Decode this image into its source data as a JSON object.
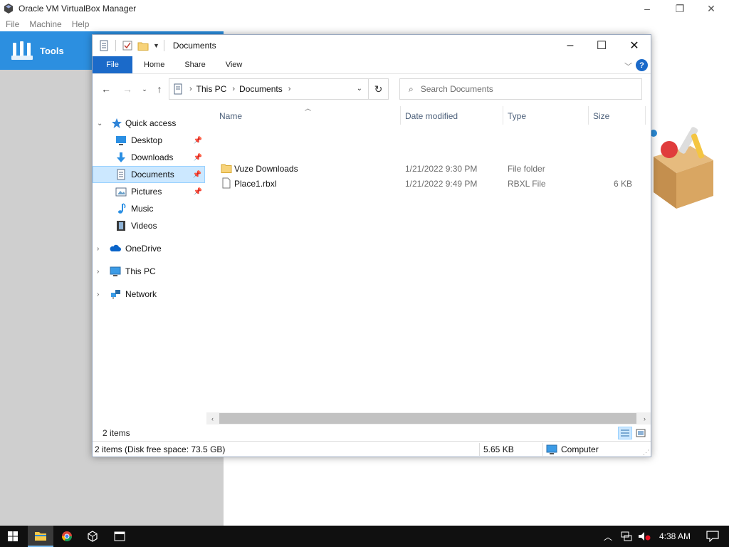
{
  "vbox": {
    "title": "Oracle VM VirtualBox Manager",
    "menu": [
      "File",
      "Machine",
      "Help"
    ],
    "tools_label": "Tools"
  },
  "explorer": {
    "title": "Documents",
    "ribbon_tabs": [
      "File",
      "Home",
      "Share",
      "View"
    ],
    "address": {
      "crumbs": [
        "This PC",
        "Documents"
      ]
    },
    "search": {
      "placeholder": "Search Documents"
    },
    "nav": {
      "quick_access": "Quick access",
      "items": [
        {
          "label": "Desktop",
          "icon": "desktop-icon",
          "pinned": true
        },
        {
          "label": "Downloads",
          "icon": "downloads-icon",
          "pinned": true
        },
        {
          "label": "Documents",
          "icon": "documents-icon",
          "pinned": true,
          "selected": true
        },
        {
          "label": "Pictures",
          "icon": "pictures-icon",
          "pinned": true
        },
        {
          "label": "Music",
          "icon": "music-icon",
          "pinned": false
        },
        {
          "label": "Videos",
          "icon": "videos-icon",
          "pinned": false
        }
      ],
      "roots": [
        {
          "label": "OneDrive",
          "icon": "onedrive-icon"
        },
        {
          "label": "This PC",
          "icon": "this-pc-icon"
        },
        {
          "label": "Network",
          "icon": "network-icon"
        }
      ]
    },
    "columns": [
      "Name",
      "Date modified",
      "Type",
      "Size"
    ],
    "files": [
      {
        "name": "Vuze Downloads",
        "date": "1/21/2022 9:30 PM",
        "type": "File folder",
        "size": ""
      },
      {
        "name": "Place1.rbxl",
        "date": "1/21/2022 9:49 PM",
        "type": "RBXL File",
        "size": "6 KB"
      }
    ],
    "items_count": "2 items",
    "status": {
      "left": "2 items (Disk free space: 73.5 GB)",
      "size": "5.65 KB",
      "location": "Computer"
    }
  },
  "taskbar": {
    "time": "4:38 AM"
  }
}
